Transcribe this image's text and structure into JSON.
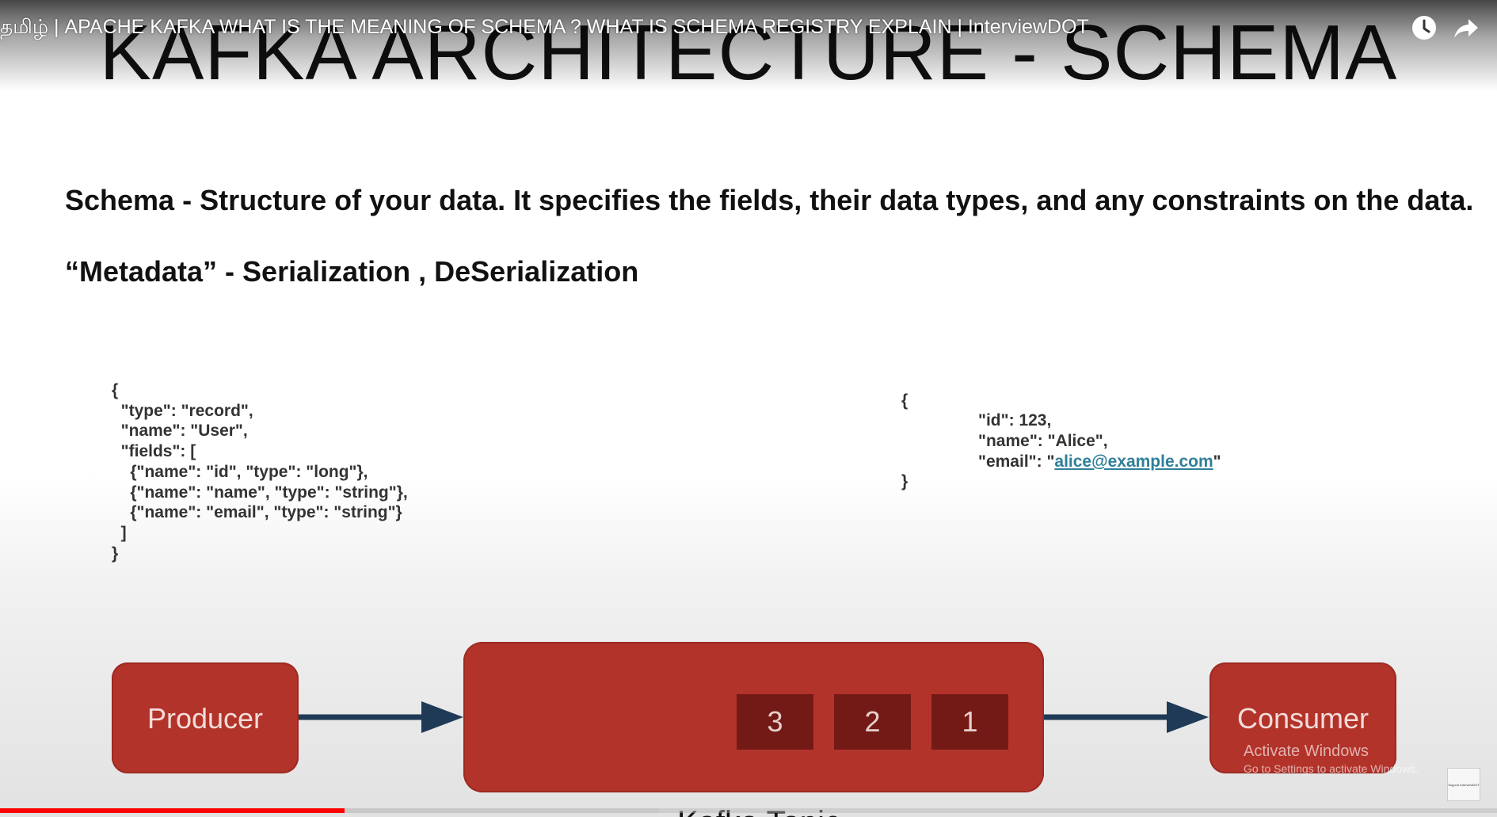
{
  "video": {
    "title": "தமிழ் | APACHE KAFKA WHAT IS THE MEANING OF SCHEMA ? WHAT IS SCHEMA REGISTRY EXPLAIN | InterviewDOT",
    "icons": [
      "watch-later-icon",
      "share-icon"
    ],
    "progress_played_fraction": 0.23,
    "progress_buffered_fraction": 0.44
  },
  "slide": {
    "title": "KAFKA ARCHITECTURE - SCHEMA",
    "heading_schema": "Schema - Structure of your data. It specifies the fields, their data types, and any constraints on the data.",
    "heading_metadata": "“Metadata” - Serialization , DeSerialization",
    "schema_code": [
      "{",
      "  \"type\": \"record\",",
      "  \"name\": \"User\",",
      "  \"fields\": [",
      "    {\"name\": \"id\", \"type\": \"long\"},",
      "    {\"name\": \"name\", \"type\": \"string\"},",
      "    {\"name\": \"email\", \"type\": \"string\"}",
      "  ]",
      "}"
    ],
    "record": {
      "open": "{",
      "id_line": "\"id\": 123,",
      "name_line": "\"name\": \"Alice\",",
      "email_prefix": "\"email\": \"",
      "email_link": "alice@example.com",
      "email_suffix": "\"",
      "close": "}"
    },
    "diagram": {
      "producer": "Producer",
      "consumer": "Consumer",
      "messages": [
        "3",
        "2",
        "1"
      ],
      "topic_label_partial": "Kafka Topic"
    }
  },
  "overlay": {
    "activate_title": "Activate Windows",
    "activate_sub": "Go to Settings to activate Windows.",
    "channel_logo": "Support InterviewDOT"
  },
  "colors": {
    "box_red": "#b2332a",
    "message_dark_red": "#731a16",
    "arrow_navy": "#1f3a56",
    "link_teal": "#2f7f99",
    "progress_red": "#ff0000"
  }
}
